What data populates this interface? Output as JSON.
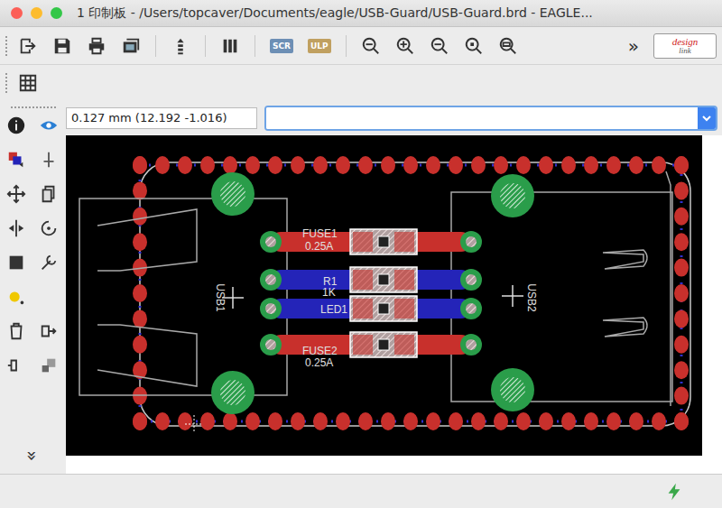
{
  "window": {
    "title": "1 印制板 - /Users/topcaver/Documents/eagle/USB-Guard/USB-Guard.brd - EAGLE..."
  },
  "toolbar": {
    "script": "SCR",
    "ulp": "ULP",
    "more": "»",
    "logo": [
      "design",
      "link"
    ]
  },
  "coordinates": "0.127 mm (12.192 -1.016)",
  "command": {
    "value": ""
  },
  "side_toolbar": {
    "more": "»"
  },
  "board": {
    "traces": [
      {
        "layer": "top",
        "color": "#c8302c"
      },
      {
        "layer": "bottom",
        "color": "#2424b8"
      },
      {
        "layer": "bottom",
        "color": "#2424b8"
      },
      {
        "layer": "top",
        "color": "#c8302c"
      }
    ],
    "parts": [
      {
        "name": "FUSE1",
        "value": "0.25A"
      },
      {
        "name": "R1",
        "value": "1K"
      },
      {
        "name": "LED1"
      },
      {
        "name": "FUSE2",
        "value": "0.25A"
      }
    ],
    "connectors": [
      {
        "name": "USB1"
      },
      {
        "name": "USB2"
      }
    ]
  }
}
